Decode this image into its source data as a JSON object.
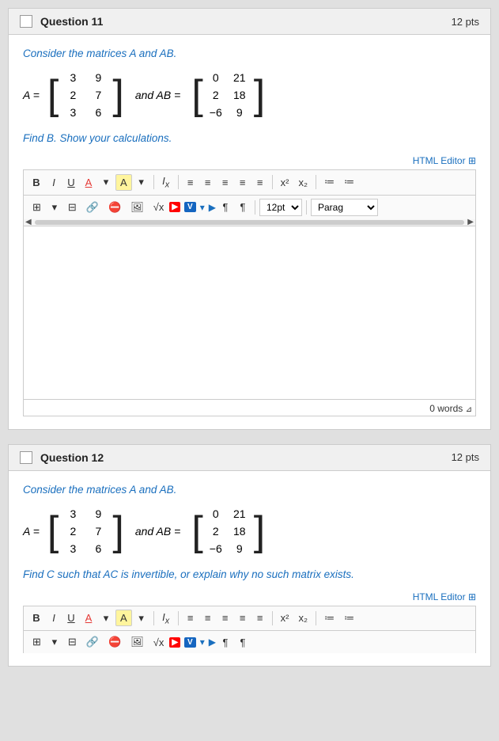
{
  "questions": [
    {
      "id": "q11",
      "title": "Question 11",
      "pts": "12 pts",
      "consider_text": "Consider the matrices A and AB.",
      "matrix_A_label": "A =",
      "matrix_A": [
        [
          "3",
          "9"
        ],
        [
          "2",
          "7"
        ],
        [
          "3",
          "6"
        ]
      ],
      "and_AB_label": "and  AB =",
      "matrix_AB": [
        [
          "0",
          "21"
        ],
        [
          "2",
          "18"
        ],
        [
          "−6",
          "9"
        ]
      ],
      "find_text": "Find B. Show your calculations.",
      "html_editor_label": "HTML Editor",
      "word_count": "0 words",
      "toolbar": {
        "row1": [
          "B",
          "I",
          "U",
          "A",
          "A",
          "Ix",
          "align-left",
          "align-center",
          "align-right",
          "align-justify",
          "align-full",
          "x²",
          "x₂",
          "list-ol",
          "list-ul"
        ],
        "row2": [
          "table",
          "img-icon",
          "link",
          "unlink",
          "image",
          "sqrt",
          "youtube",
          "vimeo",
          "arrow-down",
          "arrow-right",
          "para-mark",
          "para-mark2",
          "12pt",
          "Parag"
        ]
      }
    },
    {
      "id": "q12",
      "title": "Question 12",
      "pts": "12 pts",
      "consider_text": "Consider the matrices A and AB.",
      "matrix_A_label": "A =",
      "matrix_A": [
        [
          "3",
          "9"
        ],
        [
          "2",
          "7"
        ],
        [
          "3",
          "6"
        ]
      ],
      "and_AB_label": "and  AB =",
      "matrix_AB": [
        [
          "0",
          "21"
        ],
        [
          "2",
          "18"
        ],
        [
          "−6",
          "9"
        ]
      ],
      "find_text": "Find C such that AC is invertible, or explain why no such matrix exists.",
      "html_editor_label": "HTML Editor"
    }
  ]
}
